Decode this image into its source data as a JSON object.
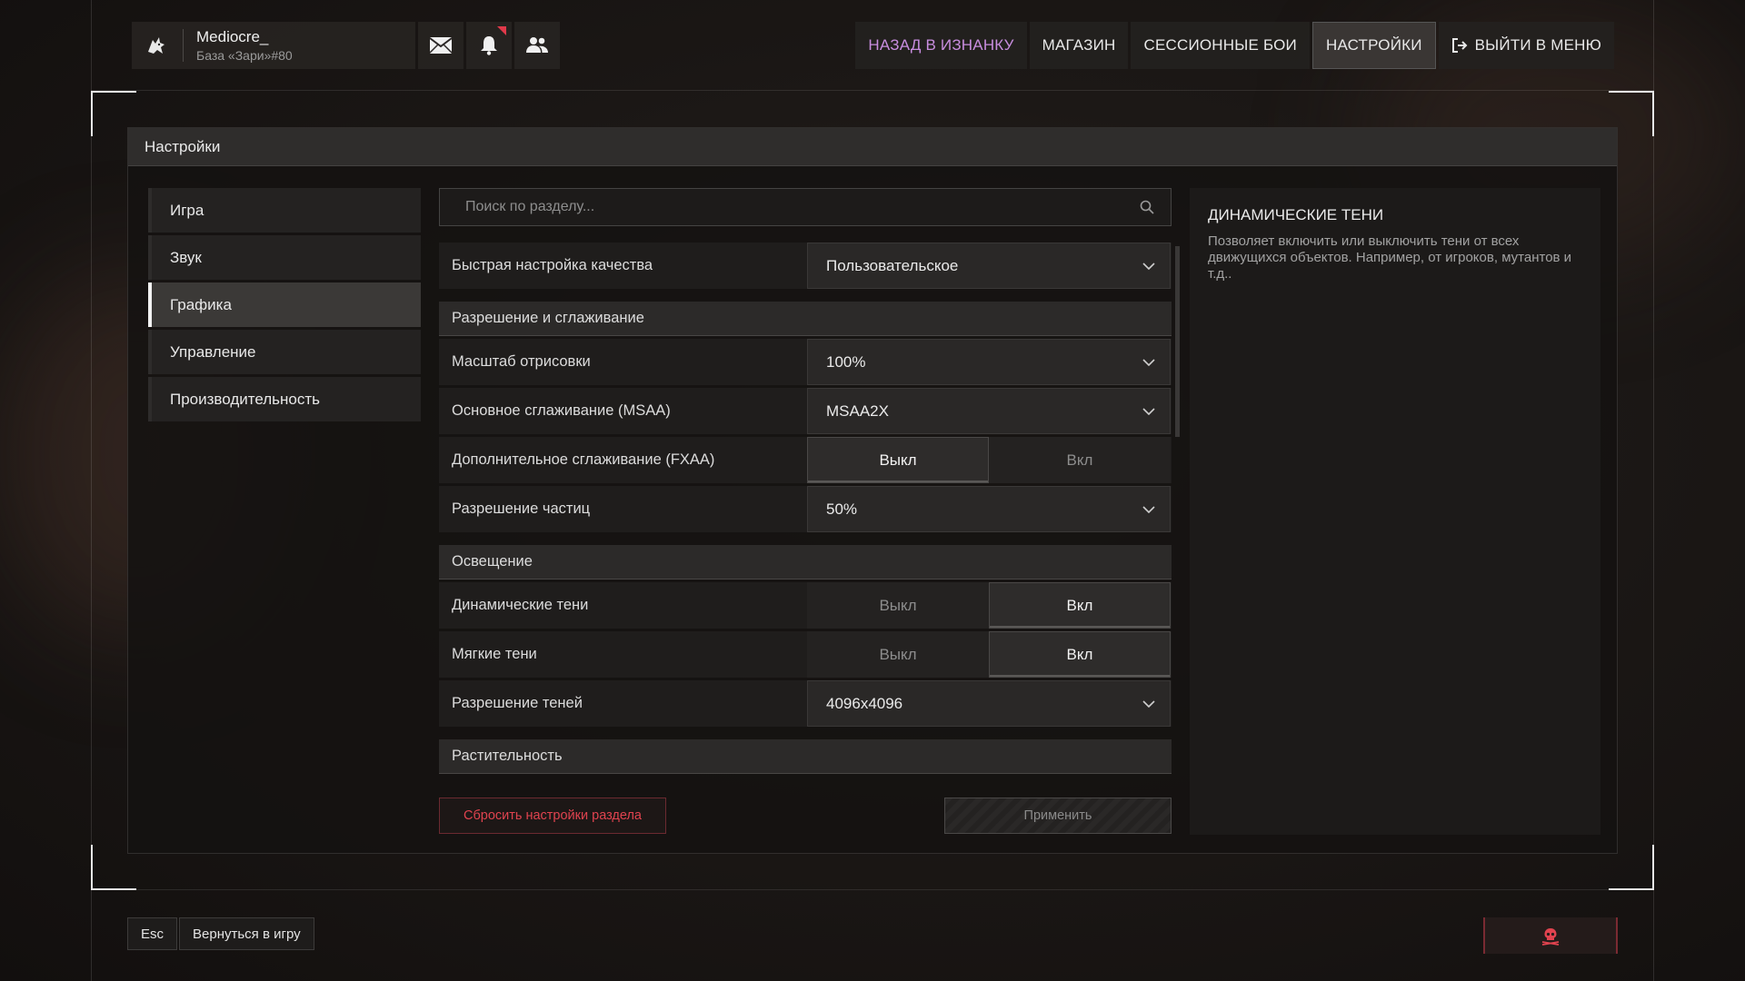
{
  "profile": {
    "name": "Mediocre_",
    "base": "База «Зари»#80"
  },
  "topnav": {
    "items": [
      {
        "label": "НАЗАД В ИЗНАНКУ"
      },
      {
        "label": "МАГАЗИН"
      },
      {
        "label": "СЕССИОННЫЕ БОИ"
      },
      {
        "label": "НАСТРОЙКИ"
      },
      {
        "label": "ВЫЙТИ В МЕНЮ"
      }
    ]
  },
  "icons": {
    "logo": "wolf-logo-icon",
    "mail": "mail-icon",
    "bell": "bell-icon",
    "friends": "friends-icon",
    "search": "search-icon",
    "chevron": "chevron-down-icon",
    "exit": "exit-icon",
    "skull": "skull-icon"
  },
  "colors": {
    "accent_purple": "#c88ddf",
    "danger_red": "#e0434f",
    "notification": "#e0394a"
  },
  "panel": {
    "title": "Настройки"
  },
  "sidebar": {
    "items": [
      {
        "label": "Игра"
      },
      {
        "label": "Звук"
      },
      {
        "label": "Графика"
      },
      {
        "label": "Управление"
      },
      {
        "label": "Производительность"
      }
    ],
    "active": "Графика"
  },
  "search": {
    "placeholder": "Поиск по разделу..."
  },
  "settings": {
    "quick_quality": {
      "label": "Быстрая настройка качества",
      "value": "Пользовательское"
    },
    "section_resolution": "Разрешение и сглаживание",
    "render_scale": {
      "label": "Масштаб отрисовки",
      "value": "100%"
    },
    "msaa": {
      "label": "Основное сглаживание (MSAA)",
      "value": "MSAA2X"
    },
    "fxaa": {
      "label": "Дополнительное сглаживание (FXAA)",
      "off": "Выкл",
      "on": "Вкл",
      "selected": "Выкл"
    },
    "particles": {
      "label": "Разрешение частиц",
      "value": "50%"
    },
    "section_lighting": "Освещение",
    "dynamic_shadows": {
      "label": "Динамические тени",
      "off": "Выкл",
      "on": "Вкл",
      "selected": "Вкл"
    },
    "soft_shadows": {
      "label": "Мягкие тени",
      "off": "Выкл",
      "on": "Вкл",
      "selected": "Вкл"
    },
    "shadow_res": {
      "label": "Разрешение теней",
      "value": "4096x4096"
    },
    "section_vegetation": "Растительность"
  },
  "actions": {
    "reset": "Сбросить настройки раздела",
    "apply": "Применить"
  },
  "description": {
    "title": "ДИНАМИЧЕСКИЕ ТЕНИ",
    "text": "Позволяет включить или выключить тени от всех движущихся объектов. Например, от игроков, мутантов и т.д.."
  },
  "bottom": {
    "key": "Esc",
    "back_label": "Вернуться в игру"
  }
}
